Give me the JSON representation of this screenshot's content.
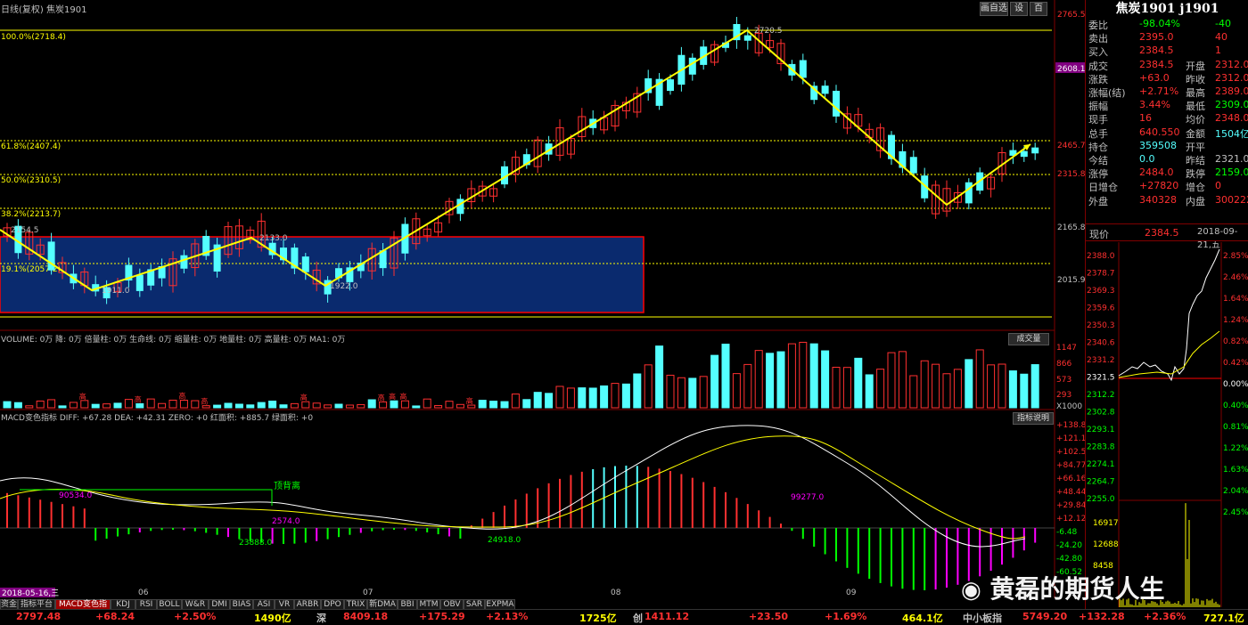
{
  "window": {
    "title_left": "日线(复权)  焦炭1901",
    "buttons": [
      "画自选",
      "设",
      "百"
    ]
  },
  "quote": {
    "title": "焦炭1901 j1901",
    "rows": [
      {
        "l1": "委比",
        "v1": "-98.04%",
        "l2": "",
        "v2": "-40"
      },
      {
        "l1": "卖出",
        "v1": "2395.0",
        "l2": "",
        "v2": "40"
      },
      {
        "l1": "买入",
        "v1": "2384.5",
        "l2": "",
        "v2": "1"
      },
      {
        "l1": "成交",
        "v1": "2384.5",
        "l2": "开盘",
        "v2": "2312.0"
      },
      {
        "l1": "涨跌",
        "v1": "+63.0",
        "l2": "昨收",
        "v2": "2312.0"
      },
      {
        "l1": "涨幅(结)",
        "v1": "+2.71%",
        "l2": "最高",
        "v2": "2389.0"
      },
      {
        "l1": "振幅",
        "v1": "3.44%",
        "l2": "最低",
        "v2": "2309.0"
      },
      {
        "l1": "现手",
        "v1": "16",
        "l2": "均价",
        "v2": "2348.0"
      },
      {
        "l1": "总手",
        "v1": "640.550",
        "l2": "金额",
        "v2": "1504亿"
      },
      {
        "l1": "持仓",
        "v1": "359508",
        "l2": "开平",
        "v2": ""
      },
      {
        "l1": "今结",
        "v1": "0.0",
        "l2": "昨结",
        "v2": "2321.0"
      },
      {
        "l1": "涨停",
        "v1": "2484.0",
        "l2": "跌停",
        "v2": "2159.0"
      },
      {
        "l1": "日增仓",
        "v1": "+27820",
        "l2": "增仓",
        "v2": "0"
      },
      {
        "l1": "外盘",
        "v1": "340328",
        "l2": "内盘",
        "v2": "300222"
      }
    ],
    "current_label": "现价",
    "current_price": "2384.5",
    "date": "2018-09-21,五"
  },
  "price_axis": [
    "2765.5",
    "2608.1",
    "2465.7",
    "2315.8",
    "2165.8",
    "2015.9"
  ],
  "fib_labels": [
    "100.0%(2718.4)",
    "61.8%(2407.4)",
    "50.0%(2310.5)",
    "38.2%(2213.7)",
    "19.1%(2057.2)"
  ],
  "annotations": {
    "high": "2720.5",
    "left_start": "2154.5",
    "low1": "1911.0",
    "mid_high": "2133.0",
    "low2": "1922.0"
  },
  "volume": {
    "legend": "VOLUME: 0万  降: 0万  倍量柱: 0万  生命线: 0万  缩量柱: 0万  地量柱: 0万  高量柱: 0万  MA1: 0万",
    "button": "成交量",
    "axis": [
      "1147",
      "866",
      "573",
      "293",
      "X1000"
    ],
    "high_mark": "高"
  },
  "macd": {
    "legend": "MACD变色指标  DIFF: +67.28  DEA: +42.31  ZERO: +0  红面积: +885.7  绿面积: +0",
    "button": "指标说明",
    "axis": [
      "+138.8",
      "+121.1",
      "+102.5",
      "+84.77",
      "+66.16",
      "+48.44",
      "+29.84",
      "+12.12",
      "-6.48",
      "-24.20",
      "-42.80",
      "-60.52"
    ],
    "labels": {
      "a": "90534.0",
      "b": "2574.0",
      "c": "23888.0",
      "d": "24918.0",
      "e": "99277.0",
      "divergence": "顶背离"
    }
  },
  "date_axis": {
    "start": "2018-05-16,三",
    "months": [
      "06",
      "07",
      "08",
      "09"
    ]
  },
  "tabs": [
    "资金",
    "指标平台",
    "MACD变色指标",
    "KDJ",
    "RSI",
    "BOLL",
    "W&R",
    "DMI",
    "BIAS",
    "ASI",
    "VR",
    "ARBR",
    "DPO",
    "TRIX",
    "新DMA",
    "BBI",
    "MTM",
    "OBV",
    "SAR",
    "EXPMA"
  ],
  "active_tab": "MACD变色指标",
  "intraday": {
    "axis_left": [
      "2388.0",
      "2378.7",
      "2369.3",
      "2359.6",
      "2350.3",
      "2340.6",
      "2331.2",
      "2321.5",
      "2312.2",
      "2302.8",
      "2293.1",
      "2283.8",
      "2274.1",
      "2264.7",
      "2255.0"
    ],
    "axis_right": [
      "2.85%",
      "2.46%",
      "1.64%",
      "1.24%",
      "0.82%",
      "0.42%",
      "0.00%",
      "0.40%",
      "0.81%",
      "1.22%",
      "1.63%",
      "2.04%",
      "2.45%"
    ],
    "vol_axis": [
      "16917",
      "12688",
      "8458"
    ]
  },
  "bottom_bar": [
    {
      "text": "2797.48",
      "color": "#ff3030"
    },
    {
      "text": "+68.24",
      "color": "#ff3030"
    },
    {
      "text": "+2.50%",
      "color": "#ff3030"
    },
    {
      "text": "1490亿",
      "color": "#ffff00"
    },
    {
      "text": "深",
      "color": "#c0c0c0"
    },
    {
      "text": "8409.18",
      "color": "#ff3030"
    },
    {
      "text": "+175.29",
      "color": "#ff3030"
    },
    {
      "text": "+2.13%",
      "color": "#ff3030"
    },
    {
      "text": "1725亿",
      "color": "#ffff00"
    },
    {
      "text": "创",
      "color": "#c0c0c0"
    },
    {
      "text": "1411.12",
      "color": "#ff3030"
    },
    {
      "text": "+23.50",
      "color": "#ff3030"
    },
    {
      "text": "+1.69%",
      "color": "#ff3030"
    },
    {
      "text": "464.1亿",
      "color": "#ffff00"
    },
    {
      "text": "中小板指",
      "color": "#c0c0c0"
    },
    {
      "text": "5749.20",
      "color": "#ff3030"
    },
    {
      "text": "+132.28",
      "color": "#ff3030"
    },
    {
      "text": "+2.36%",
      "color": "#ff3030"
    },
    {
      "text": "727.1亿",
      "color": "#ffff00"
    }
  ],
  "watermark": "黄磊的期货人生",
  "colors": {
    "up": "#ff3030",
    "down": "#54ffff",
    "fib": "#ffff00",
    "box": "#0a2a6e",
    "box_border": "#ff0000"
  }
}
